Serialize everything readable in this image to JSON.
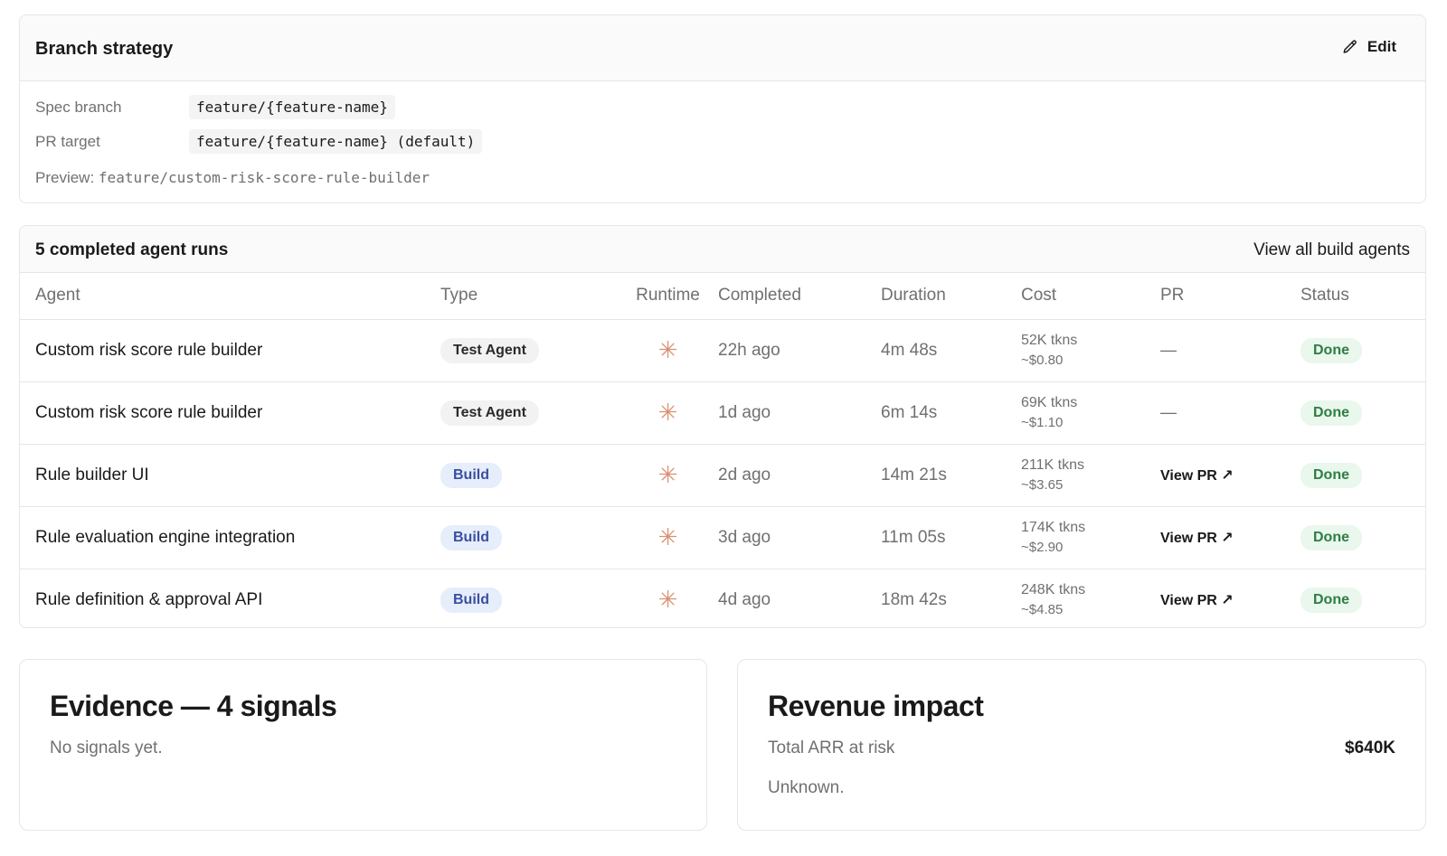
{
  "branch": {
    "title": "Branch strategy",
    "edit_label": "Edit",
    "spec_label": "Spec branch",
    "spec_value": "feature/{feature-name}",
    "pr_label": "PR target",
    "pr_value": "feature/{feature-name} (default)",
    "preview_label": "Preview:",
    "preview_value": "feature/custom-risk-score-rule-builder"
  },
  "runs": {
    "title": "5 completed agent runs",
    "view_all": "View all build agents",
    "columns": [
      "Agent",
      "Type",
      "Runtime",
      "Completed",
      "Duration",
      "Cost",
      "PR",
      "Status"
    ],
    "rows": [
      {
        "agent": "Custom risk score rule builder",
        "type": "Test Agent",
        "runtime_icon": "asterisk-spark-icon",
        "completed": "22h ago",
        "duration": "4m 48s",
        "tokens": "52K tkns",
        "cost": "~$0.80",
        "pr": "—",
        "status": "Done"
      },
      {
        "agent": "Custom risk score rule builder",
        "type": "Test Agent",
        "runtime_icon": "asterisk-spark-icon",
        "completed": "1d ago",
        "duration": "6m 14s",
        "tokens": "69K tkns",
        "cost": "~$1.10",
        "pr": "—",
        "status": "Done"
      },
      {
        "agent": "Rule builder UI",
        "type": "Build",
        "runtime_icon": "asterisk-spark-icon",
        "completed": "2d ago",
        "duration": "14m 21s",
        "tokens": "211K tkns",
        "cost": "~$3.65",
        "pr": "View PR ↗",
        "status": "Done"
      },
      {
        "agent": "Rule evaluation engine integration",
        "type": "Build",
        "runtime_icon": "asterisk-spark-icon",
        "completed": "3d ago",
        "duration": "11m 05s",
        "tokens": "174K tkns",
        "cost": "~$2.90",
        "pr": "View PR ↗",
        "status": "Done"
      },
      {
        "agent": "Rule definition & approval API",
        "type": "Build",
        "runtime_icon": "asterisk-spark-icon",
        "completed": "4d ago",
        "duration": "18m 42s",
        "tokens": "248K tkns",
        "cost": "~$4.85",
        "pr": "View PR ↗",
        "status": "Done"
      }
    ]
  },
  "evidence": {
    "title": "Evidence — 4 signals",
    "empty": "No signals yet."
  },
  "revenue": {
    "title": "Revenue impact",
    "total_label": "Total ARR at risk",
    "total_value": "$640K",
    "note": "Unknown."
  },
  "colors": {
    "build_badge_bg": "#e6edfb",
    "build_badge_fg": "#3a4fa0",
    "done_badge_bg": "#e9f7ec",
    "done_badge_fg": "#2f7d44",
    "runtime_icon": "#d99070"
  }
}
